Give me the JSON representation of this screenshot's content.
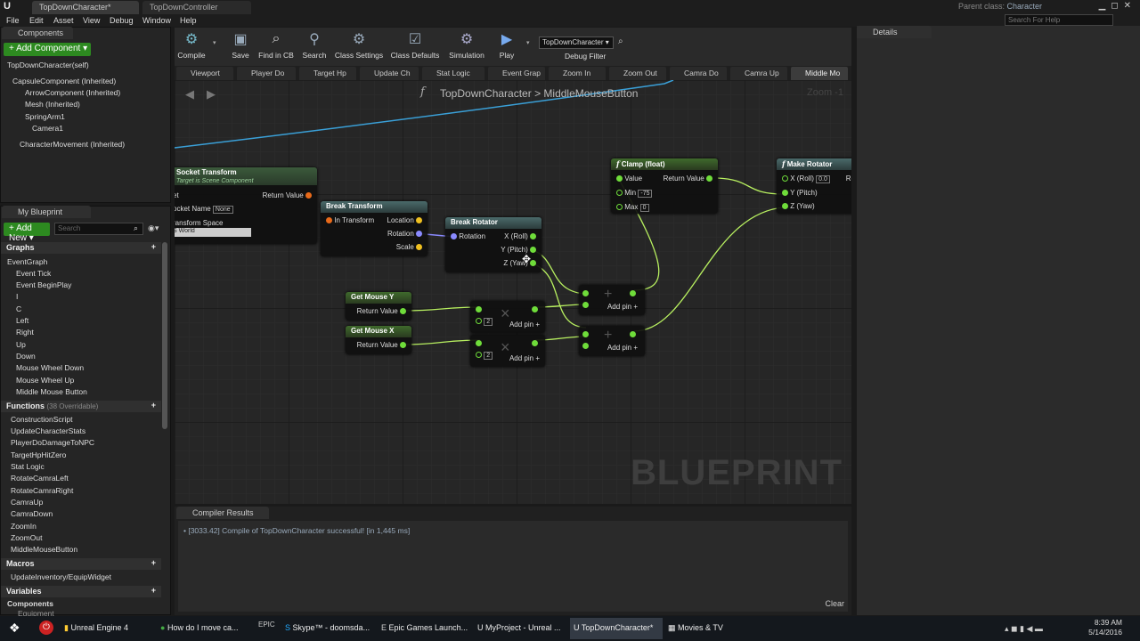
{
  "title_tabs": [
    "TopDownCharacter*",
    "TopDownController"
  ],
  "parent_class": {
    "label": "Parent class:",
    "value": "Character"
  },
  "help_search": "Search For Help",
  "menu": [
    "File",
    "Edit",
    "Asset",
    "View",
    "Debug",
    "Window",
    "Help"
  ],
  "components": {
    "tab": "Components",
    "add": "+ Add Component ▾",
    "self": "TopDownCharacter(self)",
    "tree": [
      "CapsuleComponent (Inherited)",
      "ArrowComponent (Inherited)",
      "Mesh (Inherited)",
      "SpringArm1",
      "Camera1",
      "CharacterMovement (Inherited)"
    ]
  },
  "myblueprint": {
    "tab": "My Blueprint",
    "add_new": "+ Add New ▾",
    "search": "Search",
    "graphs_head": "Graphs",
    "graphs": [
      "EventGraph",
      "Event Tick",
      "Event BeginPlay",
      "I",
      "C",
      "Left",
      "Right",
      "Up",
      "Down",
      "Mouse Wheel Down",
      "Mouse Wheel Up",
      "Middle Mouse Button"
    ],
    "functions_head": "Functions",
    "functions_note": "(38 Overridable)",
    "functions": [
      "ConstructionScript",
      "UpdateCharacterStats",
      "PlayerDoDamageToNPC",
      "TargetHpHitZero",
      "Stat Logic",
      "RotateCamraLeft",
      "RotateCamraRight",
      "CamraUp",
      "CamraDown",
      "ZoomIn",
      "ZoomOut",
      "MiddleMouseButton"
    ],
    "macros_head": "Macros",
    "macros": [
      "UpdateInventory/EquipWidget"
    ],
    "variables_head": "Variables",
    "components_sub": "Components",
    "equipment": "Equipment"
  },
  "toolbar": [
    {
      "label": "Compile",
      "icon": "⚙",
      "color": "#7bc"
    },
    {
      "label": "Save",
      "icon": "💾",
      "color": "#9ab"
    },
    {
      "label": "Find in CB",
      "icon": "🔍",
      "color": "#ccc"
    },
    {
      "label": "Search",
      "icon": "🔭",
      "color": "#9ab"
    },
    {
      "label": "Class Settings",
      "icon": "⚙",
      "color": "#9ab"
    },
    {
      "label": "Class Defaults",
      "icon": "☑",
      "color": "#9ab"
    },
    {
      "label": "Simulation",
      "icon": "⚙",
      "color": "#aac"
    },
    {
      "label": "Play",
      "icon": "▶",
      "color": "#7ae"
    }
  ],
  "debug_filter": {
    "value": "TopDownCharacter ▾",
    "label": "Debug Filter"
  },
  "fn_tabs": [
    "Viewport",
    "Player Do",
    "Target Hp",
    "Update Ch",
    "Stat Logic",
    "Event Grap",
    "Zoom In",
    "Zoom Out",
    "Camra Do",
    "Camra Up",
    "Middle Mo"
  ],
  "breadcrumb": {
    "root": "TopDownCharacter",
    "sep": ">",
    "current": "MiddleMouseButton"
  },
  "zoom": "Zoom -1",
  "watermark": "BLUEPRINT",
  "nodes": {
    "socket": {
      "title": "Socket Transform",
      "subtitle": "Target is Scene Component",
      "target": "et",
      "ret": "Return Value",
      "socket_name": "ocket Name",
      "socket_val": "None",
      "space": "ransform Space",
      "space_val": "S World"
    },
    "break_transform": {
      "title": "Break Transform",
      "in": "In Transform",
      "out": [
        "Location",
        "Rotation",
        "Scale"
      ]
    },
    "break_rotator": {
      "title": "Break Rotator",
      "in": "Rotation",
      "out": [
        "X (Roll)",
        "Y (Pitch)",
        "Z (Yaw)"
      ]
    },
    "clamp": {
      "title": "Clamp (float)",
      "value": "Value",
      "ret": "Return Value",
      "min": "Min",
      "min_val": "-75",
      "max": "Max",
      "max_val": "0"
    },
    "make_rot": {
      "title": "Make Rotator",
      "x": "X (Roll)",
      "x_val": "0.0",
      "y": "Y (Pitch)",
      "z": "Z (Yaw)",
      "ret": "Re"
    },
    "mouse_y": {
      "title": "Get Mouse Y",
      "ret": "Return Value"
    },
    "mouse_x": {
      "title": "Get Mouse X",
      "ret": "Return Value"
    },
    "mult": {
      "val": "2",
      "add": "Add pin"
    },
    "add": {
      "add": "Add pin"
    }
  },
  "compiler": {
    "tab": "Compiler Results",
    "message": "[3033.42] Compile of TopDownCharacter successful! [in 1,445 ms]",
    "clear": "Clear"
  },
  "details_tab": "Details",
  "taskbar": [
    "Unreal Engine 4",
    "How do I move ca...",
    "Skype™ - doomsda...",
    "Epic Games Launch...",
    "MyProject - Unreal ...",
    "TopDownCharacter*",
    "Movies & TV"
  ],
  "clock": {
    "time": "8:39 AM",
    "date": "5/14/2016"
  }
}
